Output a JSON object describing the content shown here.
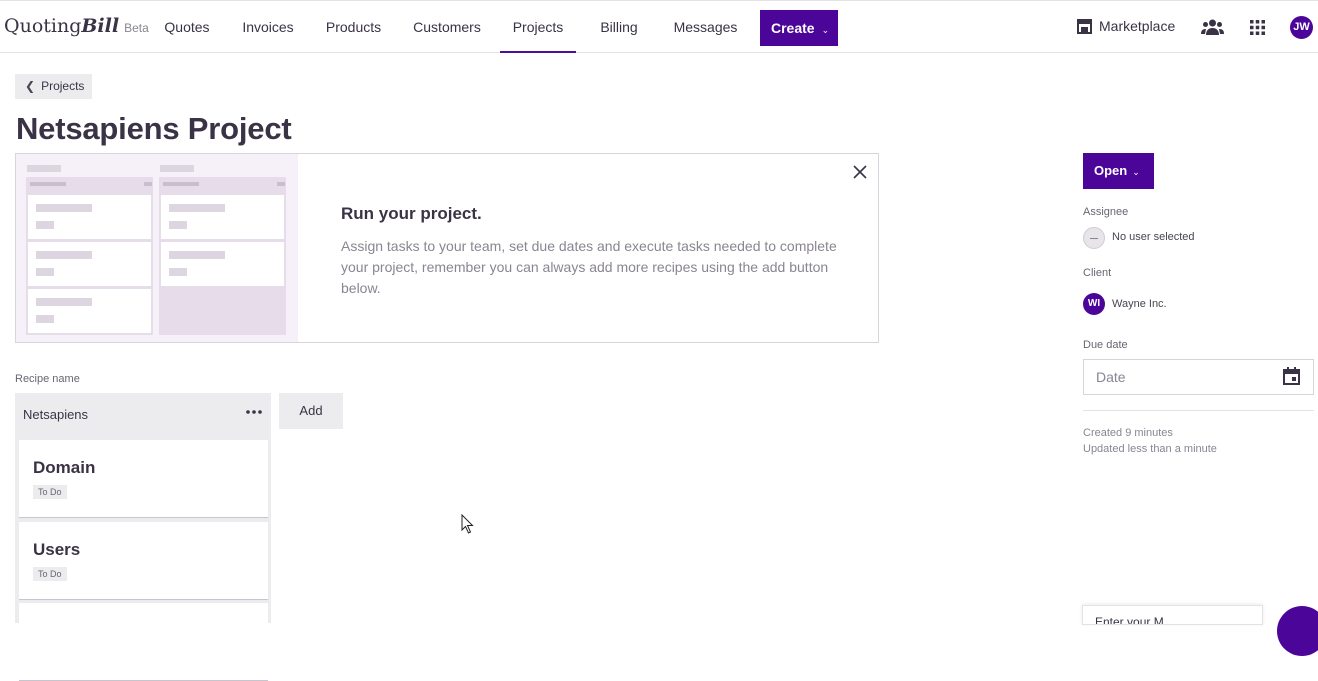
{
  "brand": {
    "name_quoting": "Quoting",
    "name_bill": "Bill",
    "beta": "Beta"
  },
  "nav": {
    "items": [
      {
        "label": "Quotes"
      },
      {
        "label": "Invoices"
      },
      {
        "label": "Products"
      },
      {
        "label": "Customers"
      },
      {
        "label": "Projects",
        "active": true
      },
      {
        "label": "Billing"
      },
      {
        "label": "Messages"
      }
    ],
    "create_label": "Create",
    "marketplace_label": "Marketplace",
    "user_initials": "JW"
  },
  "breadcrumb": {
    "back_label": "Projects"
  },
  "page": {
    "title": "Netsapiens Project"
  },
  "banner": {
    "title": "Run your project.",
    "text": "Assign tasks to your team, set due dates and execute tasks needed to complete your project, remember you can always add more recipes using the add button below."
  },
  "recipe": {
    "label": "Recipe name",
    "name": "Netsapiens",
    "add_label": "Add",
    "tasks": [
      {
        "title": "Domain",
        "status": "To Do"
      },
      {
        "title": "Users",
        "status": "To Do"
      }
    ]
  },
  "sidebar": {
    "status_label": "Open",
    "assignee_label": "Assignee",
    "assignee_value": "No user selected",
    "client_label": "Client",
    "client_initials": "WI",
    "client_name": "Wayne Inc.",
    "due_label": "Due date",
    "due_placeholder": "Date",
    "created": "Created 9 minutes",
    "updated": "Updated less than a minute"
  },
  "popup": {
    "peek_text": "Enter your M..."
  },
  "colors": {
    "accent": "#4b0599",
    "text": "#3a3346",
    "muted": "#8a8592",
    "surface": "#ececef"
  }
}
